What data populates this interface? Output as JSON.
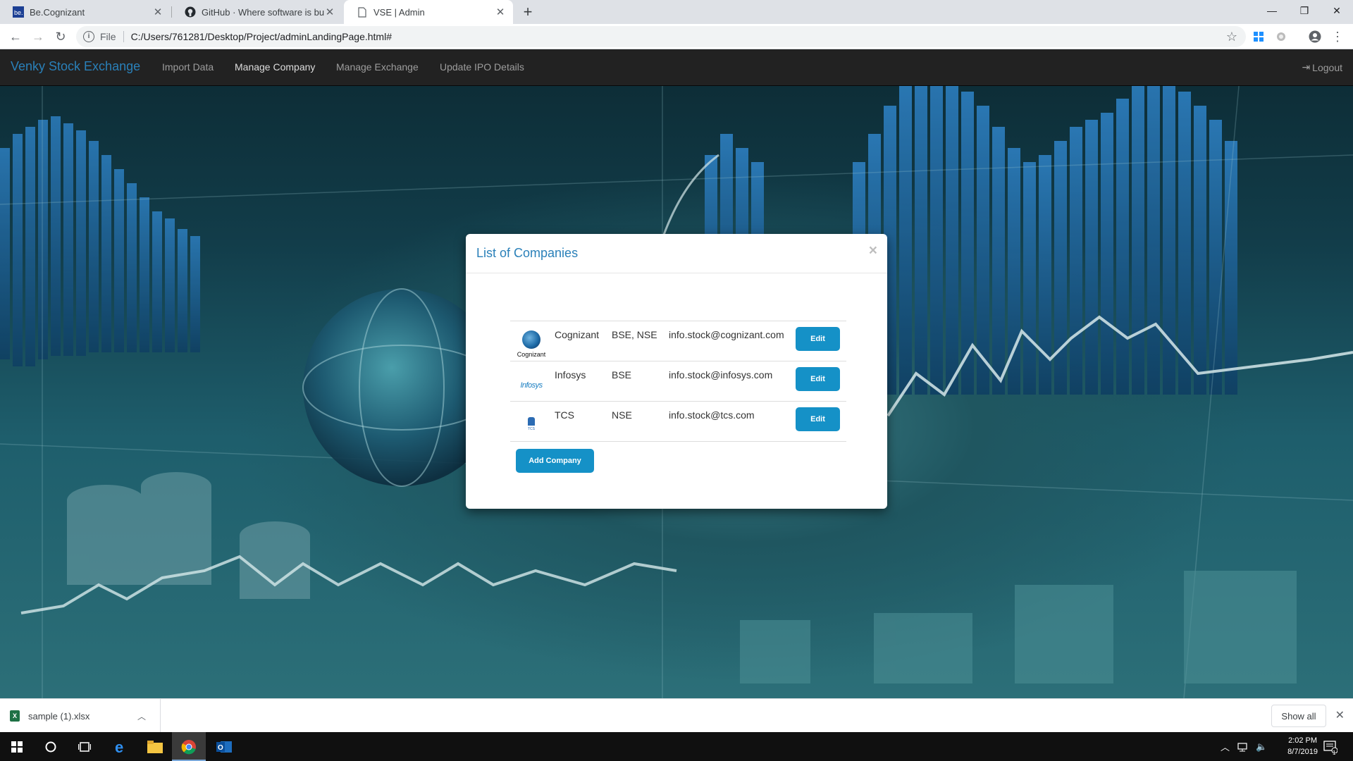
{
  "browser": {
    "tabs": [
      {
        "title": "Be.Cognizant",
        "icon": "becognizant-icon"
      },
      {
        "title": "GitHub · Where software is built",
        "icon": "github-icon"
      },
      {
        "title": "VSE | Admin",
        "icon": "page-icon",
        "active": true
      }
    ],
    "address": {
      "scheme": "File",
      "url": "C:/Users/761281/Desktop/Project/adminLandingPage.html#"
    }
  },
  "navbar": {
    "brand": "Venky Stock Exchange",
    "links": [
      "Import Data",
      "Manage Company",
      "Manage Exchange",
      "Update IPO Details"
    ],
    "active_link": "Manage Company",
    "logout": "Logout"
  },
  "modal": {
    "title": "List of Companies",
    "close": "×",
    "companies": [
      {
        "logo": "cognizant-logo",
        "logo_text": "Cognizant",
        "name": "Cognizant",
        "exchanges": "BSE, NSE",
        "email": "info.stock@cognizant.com",
        "action": "Edit"
      },
      {
        "logo": "infosys-logo",
        "logo_text": "Infosys",
        "name": "Infosys",
        "exchanges": "BSE",
        "email": "info.stock@infosys.com",
        "action": "Edit"
      },
      {
        "logo": "tcs-logo",
        "logo_text": "TCS",
        "name": "TCS",
        "exchanges": "NSE",
        "email": "info.stock@tcs.com",
        "action": "Edit"
      }
    ],
    "add_button": "Add Company"
  },
  "downloads": {
    "file": "sample (1).xlsx",
    "show_all": "Show all"
  },
  "taskbar": {
    "time": "2:02 PM",
    "date": "8/7/2019",
    "notification_count": "1"
  },
  "colors": {
    "brand": "#2a80b9",
    "button": "#1591c7",
    "navbar": "#222222"
  }
}
